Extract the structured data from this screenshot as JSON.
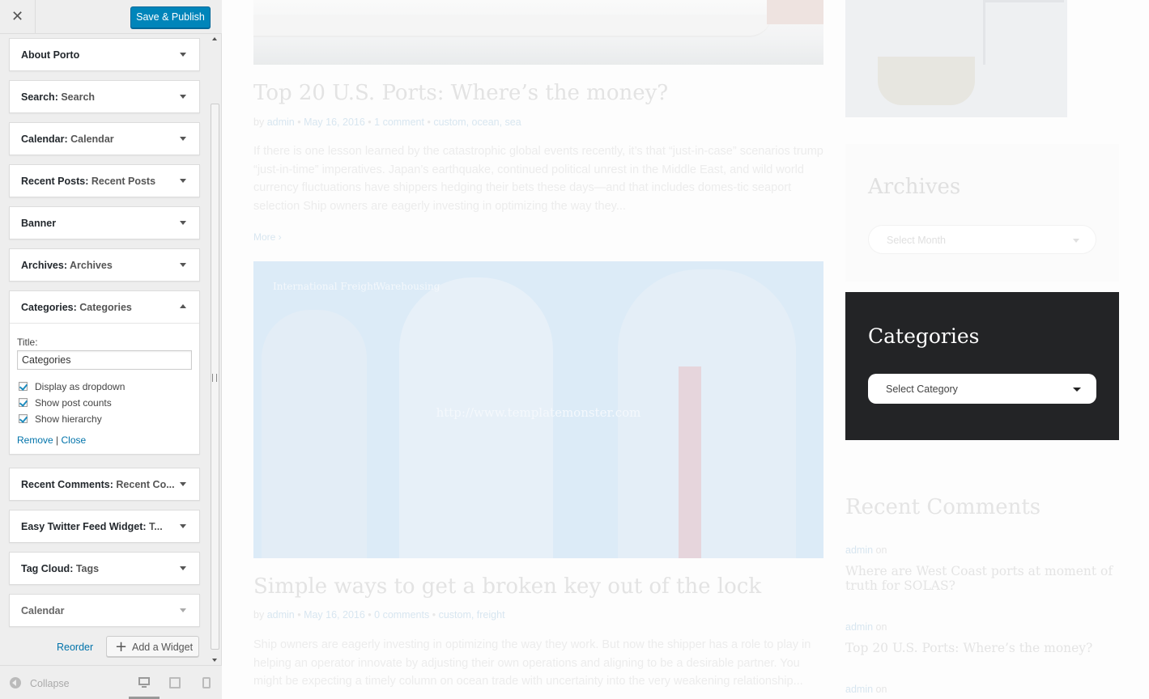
{
  "customizer": {
    "close_label": "✕",
    "publish_label": "Save & Publish",
    "widgets": [
      {
        "name": "About Porto",
        "subtitle": ""
      },
      {
        "name": "Search",
        "subtitle": "Search"
      },
      {
        "name": "Calendar",
        "subtitle": "Calendar"
      },
      {
        "name": "Recent Posts",
        "subtitle": "Recent Posts"
      },
      {
        "name": "Banner",
        "subtitle": ""
      },
      {
        "name": "Archives",
        "subtitle": "Archives"
      },
      {
        "name": "Categories",
        "subtitle": "Categories",
        "expanded": true
      },
      {
        "name": "Recent Comments",
        "subtitle": "Recent Co..."
      },
      {
        "name": "Easy Twitter Feed Widget",
        "subtitle": "T..."
      },
      {
        "name": "Tag Cloud",
        "subtitle": "Tags"
      },
      {
        "name": "Calendar",
        "subtitle": ""
      }
    ],
    "categories_form": {
      "title_label": "Title:",
      "title_value": "Categories",
      "options": [
        {
          "label": "Display as dropdown",
          "checked": true
        },
        {
          "label": "Show post counts",
          "checked": true
        },
        {
          "label": "Show hierarchy",
          "checked": true
        }
      ],
      "remove_label": "Remove",
      "separator": "|",
      "close_label": "Close"
    },
    "reorder_label": "Reorder",
    "add_widget_label": "Add a Widget",
    "collapse_label": "Collapse"
  },
  "preview": {
    "post1": {
      "title": "Top 20 U.S. Ports: Where’s the money?",
      "by": "by",
      "author": "admin",
      "date": "May 16, 2016",
      "comments": "1 comment",
      "tags": "custom, ocean, sea",
      "excerpt": "If there is one lesson learned by the catastrophic global events recently, it’s that “just-in-case” scenarios trump “just-in-time” imperatives. Japan’s earthquake, continued political unrest in the Middle East, and wild world currency fluctuations have shippers hedging their bets these days—and that includes domes-tic seaport selection Ship owners are eagerly investing in optimizing the way they...",
      "more": "More"
    },
    "feature": {
      "tag1": "International Freight",
      "tag2": "Warehousing",
      "url": "http://www.templatemonster.com"
    },
    "post2": {
      "title": "Simple ways to get a broken key out of the lock",
      "by": "by",
      "author": "admin",
      "date": "May 16, 2016",
      "comments": "0 comments",
      "tags": "custom, freight",
      "excerpt": "Ship owners are eagerly investing in optimizing the way they work. But now the shipper has a role to play in helping an operator innovate by adjusting their own operations and aligning to be a desirable partner. You might be expecting a timely column on ocean trade with uncertainty into the very weakening relationship..."
    },
    "archives": {
      "title": "Archives",
      "select": "Select Month"
    },
    "categories": {
      "title": "Categories",
      "select": "Select Category"
    },
    "recent_comments": {
      "title": "Recent Comments",
      "items": [
        {
          "author": "admin",
          "on": "on",
          "post": "Where are West Coast ports at moment of truth for SOLAS?"
        },
        {
          "author": "admin",
          "on": "on",
          "post": "Top 20 U.S. Ports: Where’s the money?"
        },
        {
          "author": "admin",
          "on": "on",
          "post": ""
        }
      ]
    }
  }
}
